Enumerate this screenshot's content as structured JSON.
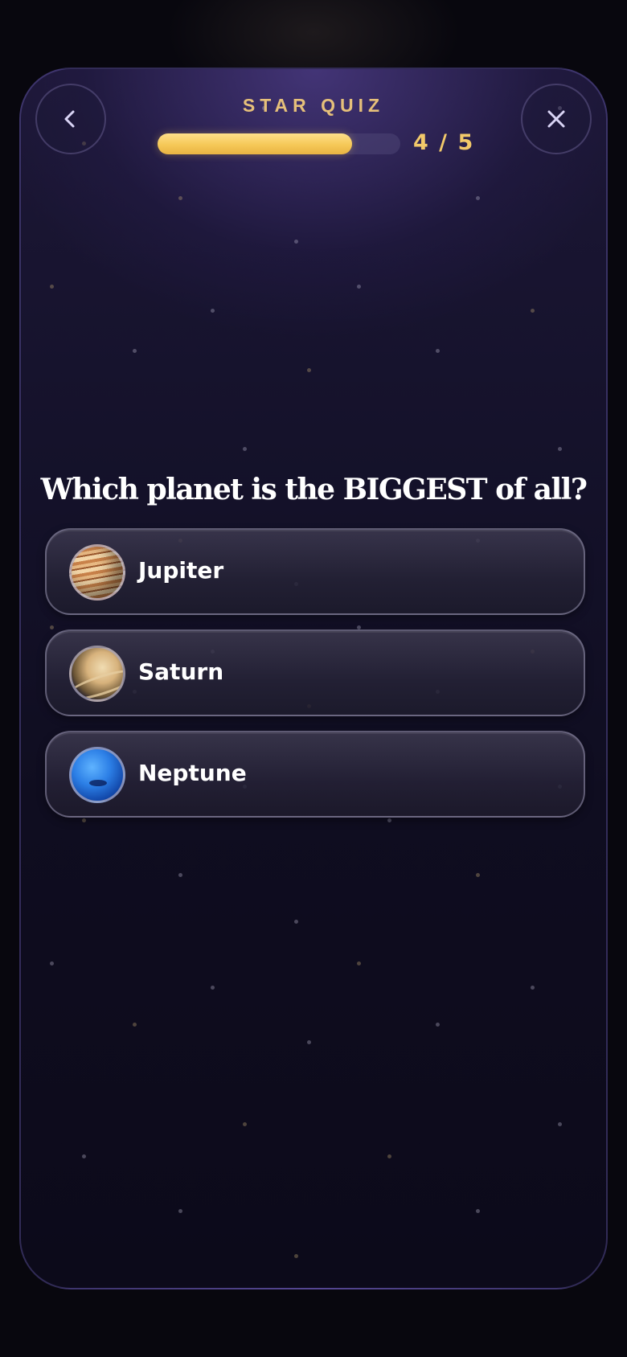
{
  "header": {
    "title": "STAR QUIZ",
    "progress_text": "4 / 5",
    "progress_fraction": 0.8,
    "back_icon": "chevron-left-icon",
    "close_icon": "close-icon"
  },
  "question": {
    "text": "Which planet is the BIGGEST of all?"
  },
  "options": [
    {
      "label": "Jupiter",
      "icon": "jupiter-icon"
    },
    {
      "label": "Saturn",
      "icon": "saturn-icon"
    },
    {
      "label": "Neptune",
      "icon": "neptune-icon"
    }
  ],
  "colors": {
    "accent": "#f2c96a",
    "background": "#0c0a1a",
    "text": "#ffffff"
  }
}
